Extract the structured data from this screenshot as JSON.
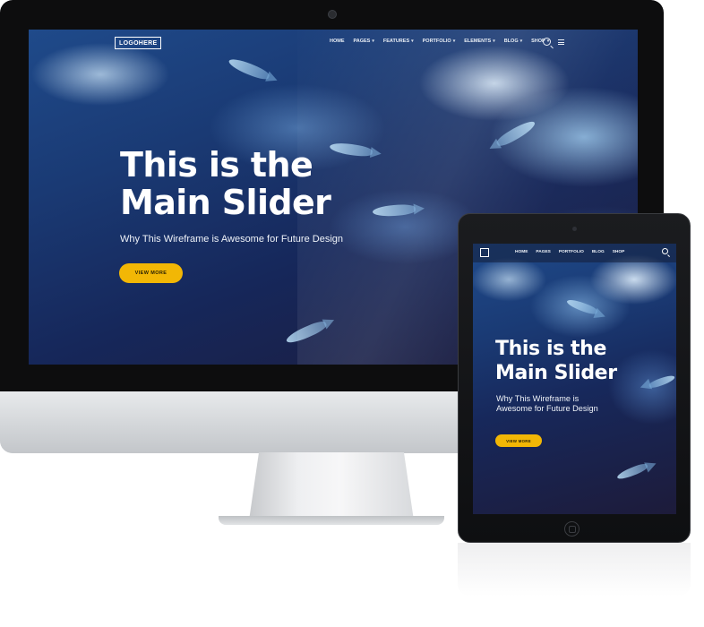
{
  "desktop": {
    "logo": "LOGOHERE",
    "menu": [
      "HOME",
      "PAGES",
      "FEATURES",
      "PORTFOLIO",
      "ELEMENTS",
      "BLOG",
      "SHOP"
    ],
    "menu_with_caret": [
      false,
      true,
      true,
      true,
      true,
      true,
      true
    ],
    "search_icon": "search-icon",
    "menu_icon": "hamburger-icon",
    "hero": {
      "title_line1": "This is the",
      "title_line2": "Main Slider",
      "subtitle": "Why This Wireframe is Awesome for Future Design",
      "button": "VIEW MORE"
    }
  },
  "tablet": {
    "menu": [
      "HOME",
      "PAGES",
      "PORTFOLIO",
      "BLOG",
      "SHOP"
    ],
    "search_icon": "search-icon",
    "hero": {
      "title_line1": "This is the",
      "title_line2": "Main Slider",
      "subtitle": "Why This Wireframe is Awesome for Future Design",
      "button": "VIEW MORE"
    }
  },
  "colors": {
    "accent": "#f2b705",
    "hero_text": "#ffffff",
    "ocean_dark": "#1d1b3a",
    "ocean_mid": "#1a3a74"
  }
}
